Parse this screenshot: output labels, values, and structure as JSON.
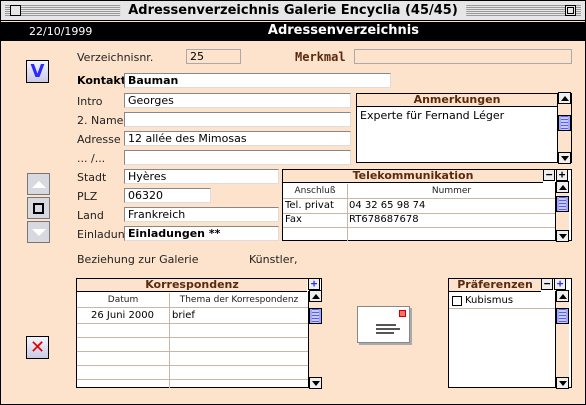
{
  "window": {
    "title": "Adressenverzeichnis Galerie Encyclia (45/45)"
  },
  "header": {
    "date": "22/10/1999",
    "heading": "Adressenverzeichnis"
  },
  "form": {
    "verzeichnisnr_label": "Verzeichnisnr.",
    "verzeichnisnr_value": "25",
    "merkmal_label": "Merkmal",
    "merkmal_value": "",
    "kontakt_label": "Kontakt",
    "kontakt_value": "Bauman",
    "intro_label": "Intro",
    "intro_value": "Georges",
    "name2_label": "2. Name",
    "name2_value": "",
    "adresse_label": "Adresse",
    "adresse_value": "12 allée des Mimosas",
    "adresse2_label": "... /...",
    "adresse2_value": "",
    "stadt_label": "Stadt",
    "stadt_value": "Hyères",
    "plz_label": "PLZ",
    "plz_value": "06320",
    "land_label": "Land",
    "land_value": "Frankreich",
    "einladung_label": "Einladung",
    "einladung_value": "Einladungen **",
    "beziehung_label": "Beziehung zur Galerie",
    "beziehung_value": "Künstler,"
  },
  "anmerkungen": {
    "title": "Anmerkungen",
    "text": "Experte für Fernand Léger"
  },
  "telekom": {
    "title": "Telekommunikation",
    "columns": [
      "Anschluß",
      "Nummer"
    ],
    "rows": [
      {
        "type": "Tel. privat",
        "number": "04 32 65 98 74"
      },
      {
        "type": "Fax",
        "number": "RT678687678"
      }
    ],
    "minus": "−",
    "plus": "+"
  },
  "korrespondenz": {
    "title": "Korrespondenz",
    "columns": [
      "Datum",
      "Thema der Korrespondenz"
    ],
    "rows": [
      {
        "date": "26 Juni 2000",
        "topic": "brief"
      }
    ],
    "plus": "+"
  },
  "praeferenzen": {
    "title": "Präferenzen",
    "items": [
      {
        "label": "Kubismus",
        "checked": false
      }
    ],
    "minus": "−",
    "plus": "+"
  },
  "buttons": {
    "validate_glyph": "V",
    "delete_glyph": "✕"
  },
  "colors": {
    "background": "#fde3cc",
    "header": "#000000",
    "accent_blue": "#2a2aff",
    "delete_red": "#e00000"
  }
}
